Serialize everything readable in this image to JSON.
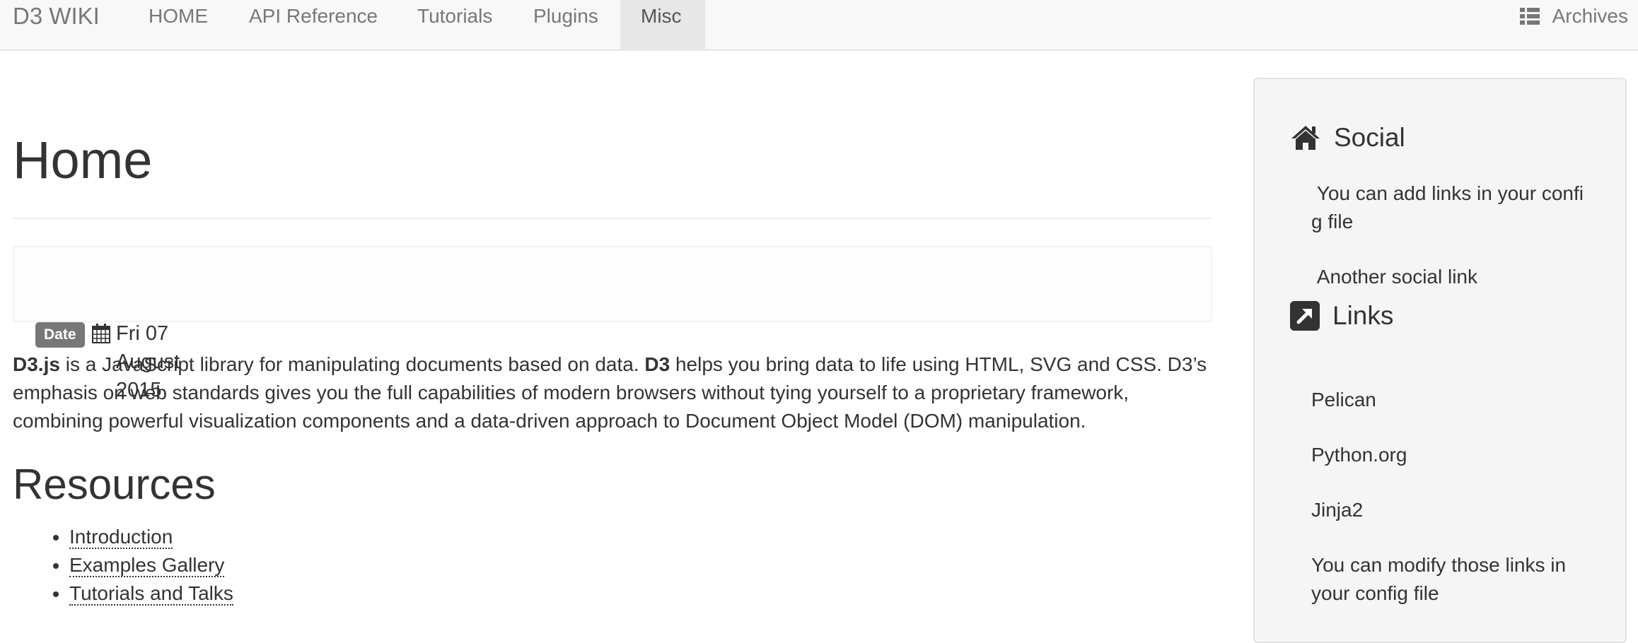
{
  "navbar": {
    "brand": "D3 WIKI",
    "items": [
      {
        "label": "HOME",
        "active": false
      },
      {
        "label": "API Reference",
        "active": false
      },
      {
        "label": "Tutorials",
        "active": false
      },
      {
        "label": "Plugins",
        "active": false
      },
      {
        "label": "Misc",
        "active": true
      }
    ],
    "archives_label": "Archives",
    "archives_icon": "list-icon"
  },
  "main": {
    "title": "Home",
    "date": {
      "label": "Date",
      "icon": "calendar-icon",
      "value": "Fri 07 August 2015"
    },
    "intro": {
      "part1_bold": "D3.js",
      "part2": " is a JavaScript library for manipulating documents based on data. ",
      "part3_bold": "D3",
      "part4": " helps you bring data to life using HTML, SVG and CSS. D3’s emphasis on web standards gives you the full capabilities of modern browsers without tying yourself to a proprietary framework, combining powerful visualization components and a data-driven approach to Document Object Model (DOM) manipulation."
    },
    "resources_title": "Resources",
    "resources": [
      "Introduction",
      "Examples Gallery",
      "Tutorials and Talks"
    ]
  },
  "sidebar": {
    "social": {
      "heading": "Social",
      "icon": "home-icon",
      "links": [
        "You can add links in your config file",
        "Another social link"
      ]
    },
    "links": {
      "heading": "Links",
      "icon": "external-link-icon",
      "items": [
        "Pelican",
        "Python.org",
        "Jinja2",
        "You can modify those links in your config file"
      ]
    }
  },
  "colors": {
    "navbar_bg": "#f8f8f8",
    "nav_text": "#777777",
    "active_bg": "#e7e7e7",
    "label_bg": "#777777",
    "sidebar_bg": "#f5f5f5",
    "text": "#333333"
  }
}
